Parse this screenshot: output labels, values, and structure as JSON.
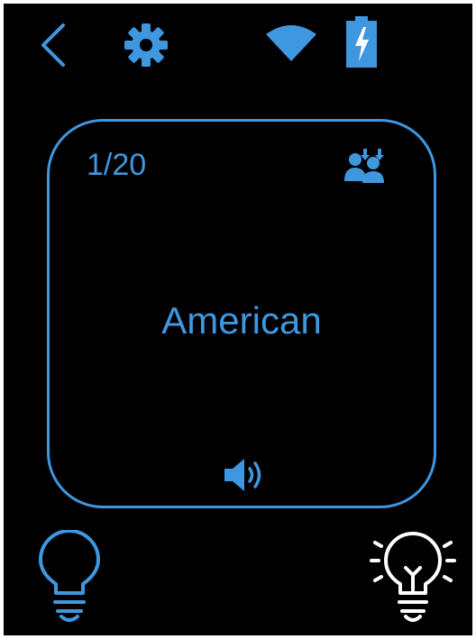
{
  "colors": {
    "accent": "#3f97e0",
    "background": "#000000",
    "highlight": "#ffffff"
  },
  "topbar": {
    "back_icon": "chevron-left",
    "settings_icon": "gear",
    "wifi_icon": "wifi",
    "battery_icon": "battery-charging"
  },
  "card": {
    "counter": "1/20",
    "word": "American",
    "users_icon": "users-swap",
    "sound_icon": "speaker"
  },
  "bottom": {
    "hint_off_icon": "lightbulb-outline",
    "hint_on_icon": "lightbulb-lit"
  }
}
